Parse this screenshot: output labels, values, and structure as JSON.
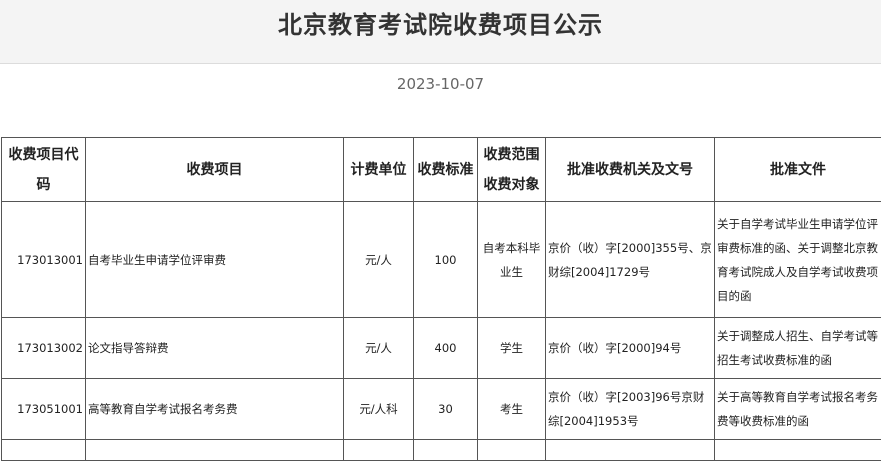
{
  "page": {
    "title": "北京教育考试院收费项目公示",
    "date": "2023-10-07"
  },
  "table": {
    "headers": {
      "code": "收费项目代码",
      "item": "收费项目",
      "unit": "计费单位",
      "standard": "收费标准",
      "scope": "收费范围收费对象",
      "authority": "批准收费机关及文号",
      "document": "批准文件"
    },
    "rows": [
      {
        "code": "173013001",
        "item": "自考毕业生申请学位评审费",
        "unit": "元/人",
        "standard": "100",
        "scope": "自考本科毕业生",
        "authority": "京价（收）字[2000]355号、京财综[2004]1729号",
        "document": "关于自学考试毕业生申请学位评审费标准的函、关于调整北京教育考试院成人及自学考试收费项目的函"
      },
      {
        "code": "173013002",
        "item": "论文指导答辩费",
        "unit": "元/人",
        "standard": "400",
        "scope": "学生",
        "authority": "京价（收）字[2000]94号",
        "document": "关于调整成人招生、自学考试等招生考试收费标准的函"
      },
      {
        "code": "173051001",
        "item": "高等教育自学考试报名考务费",
        "unit": "元/人科",
        "standard": "30",
        "scope": "考生",
        "authority": "京价（收）字[2003]96号京财综[2004]1953号",
        "document": "关于高等教育自学考试报名考务费等收费标准的函"
      }
    ]
  }
}
